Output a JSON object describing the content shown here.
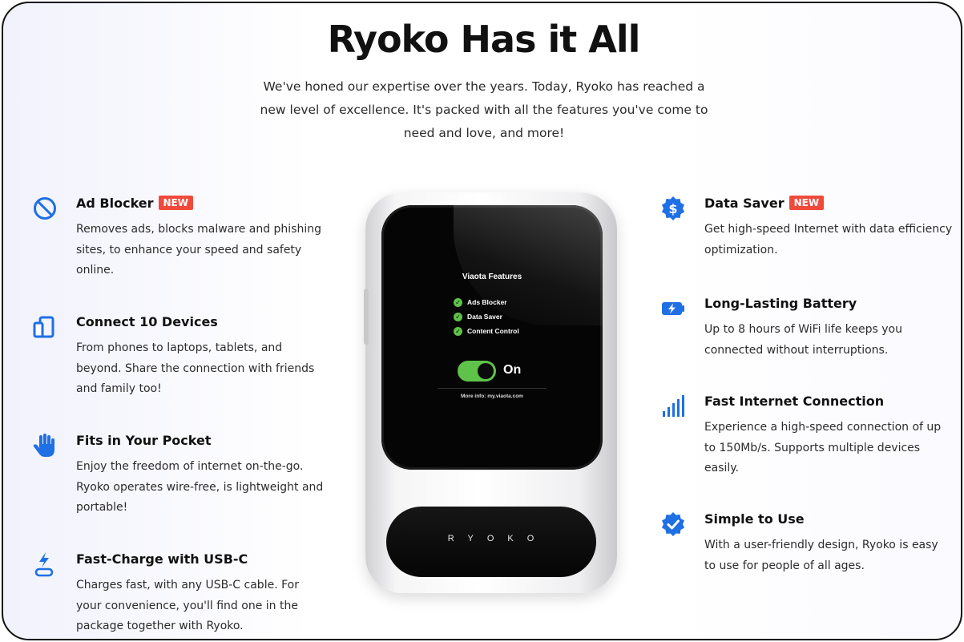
{
  "title": "Ryoko Has it All",
  "intro": "We've honed our expertise over the years. Today, Ryoko has reached a new level of excellence. It's packed with all the features you've come to need and love, and more!",
  "badge_label": "NEW",
  "accent_color": "#1f6fe5",
  "badge_color": "#f04a3b",
  "left_features": [
    {
      "icon": "block-icon",
      "title": "Ad Blocker",
      "new": true,
      "desc": "Removes ads, blocks malware and phishing sites, to enhance your speed and safety online."
    },
    {
      "icon": "devices-icon",
      "title": "Connect 10 Devices",
      "new": false,
      "desc": "From phones to laptops, tablets, and beyond. Share the connection with friends and family too!"
    },
    {
      "icon": "hand-icon",
      "title": "Fits in Your Pocket",
      "new": false,
      "desc": "Enjoy the freedom of internet on-the-go. Ryoko operates wire-free, is lightweight and portable!"
    },
    {
      "icon": "usb-c-charge-icon",
      "title": "Fast-Charge with USB-C",
      "new": false,
      "desc": "Charges fast, with any USB-C cable. For your convenience, you'll find one in the package together with Ryoko."
    }
  ],
  "right_features": [
    {
      "icon": "dollar-badge-icon",
      "title": "Data Saver",
      "new": true,
      "desc": "Get high-speed Internet with data efficiency optimization."
    },
    {
      "icon": "battery-bolt-icon",
      "title": "Long-Lasting Battery",
      "new": false,
      "desc": "Up to 8 hours of WiFi life keeps you connected without interruptions."
    },
    {
      "icon": "signal-bars-icon",
      "title": "Fast Internet Connection",
      "new": false,
      "desc": "Experience a high-speed connection of up to 150Mb/s. Supports multiple devices easily."
    },
    {
      "icon": "check-badge-icon",
      "title": "Simple to Use",
      "new": false,
      "desc": "With a user-friendly design, Ryoko is easy to use for people of all ages."
    }
  ],
  "device": {
    "screen_title": "Viaota Features",
    "items": [
      "Ads Blocker",
      "Data Saver",
      "Content Control"
    ],
    "toggle_label": "On",
    "toggle_state": "on",
    "info": "More info: my.viaota.com",
    "brand": "RYOKO"
  }
}
